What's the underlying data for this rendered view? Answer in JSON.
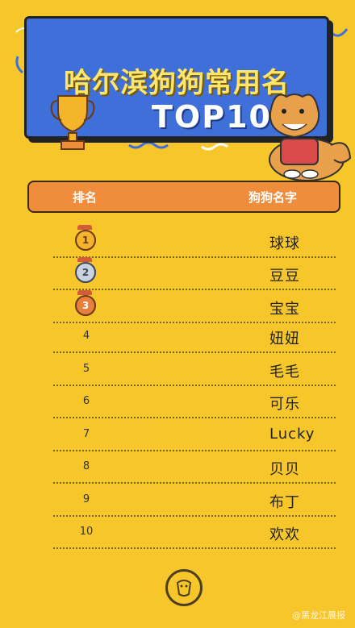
{
  "banner": {
    "title": "哈尔滨狗狗常用名",
    "subtitle": "TOP10"
  },
  "table": {
    "headers": {
      "rank": "排名",
      "name": "狗狗名字"
    },
    "rows": [
      {
        "rank": "1",
        "name": "球球",
        "medal": "gold"
      },
      {
        "rank": "2",
        "name": "豆豆",
        "medal": "silver"
      },
      {
        "rank": "3",
        "name": "宝宝",
        "medal": "bronze"
      },
      {
        "rank": "4",
        "name": "妞妞"
      },
      {
        "rank": "5",
        "name": "毛毛"
      },
      {
        "rank": "6",
        "name": "可乐"
      },
      {
        "rank": "7",
        "name": "Lucky"
      },
      {
        "rank": "8",
        "name": "贝贝"
      },
      {
        "rank": "9",
        "name": "布丁"
      },
      {
        "rank": "10",
        "name": "欢欢"
      }
    ]
  },
  "watermark": "@黑龙江晨报",
  "colors": {
    "background": "#f7c62b",
    "banner": "#3f6fd9",
    "header": "#f08d3d"
  },
  "icons": [
    "trophy-icon",
    "shiba-dog-illustration",
    "dog-badge-icon"
  ]
}
